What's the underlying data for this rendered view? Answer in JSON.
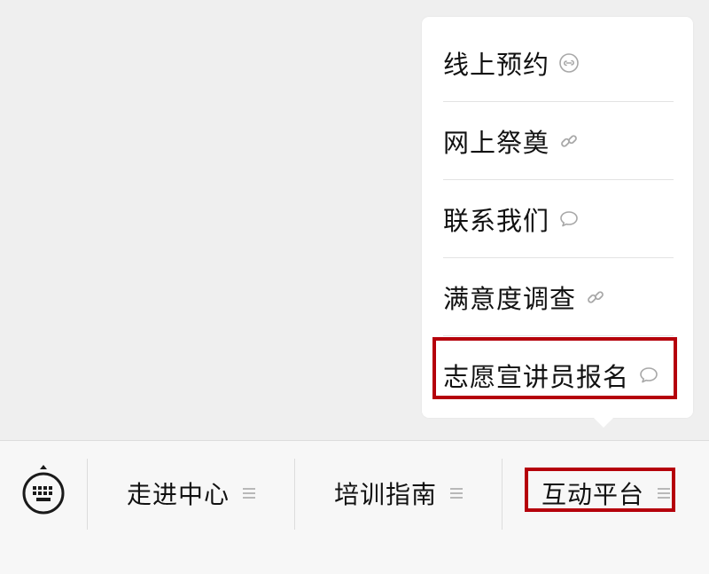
{
  "submenu": {
    "items": [
      {
        "label": "线上预约",
        "icon": "mini-program-icon"
      },
      {
        "label": "网上祭奠",
        "icon": "link-icon"
      },
      {
        "label": "联系我们",
        "icon": "chat-bubble-icon"
      },
      {
        "label": "满意度调查",
        "icon": "link-icon"
      },
      {
        "label": "志愿宣讲员报名",
        "icon": "chat-bubble-icon"
      }
    ]
  },
  "menubar": {
    "keyboard_icon": "keyboard-icon",
    "tabs": [
      {
        "label": "走进中心",
        "icon": "hamburger-icon"
      },
      {
        "label": "培训指南",
        "icon": "hamburger-icon"
      },
      {
        "label": "互动平台",
        "icon": "hamburger-icon"
      }
    ]
  },
  "colors": {
    "highlight": "#b5000b",
    "background": "#efefef",
    "menubar": "#f7f7f7",
    "icon_gray": "#a8a8a8"
  }
}
